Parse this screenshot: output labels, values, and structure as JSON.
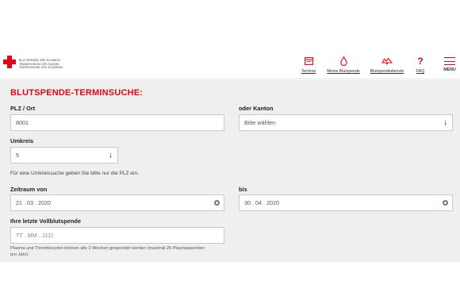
{
  "logo": {
    "line1": "Blutspende SRK Schweiz",
    "line2": "Transfusion CRS Suisse",
    "line3": "Trasfusione CRS Svizzera"
  },
  "nav": {
    "termine": "Termine",
    "meine": "Meine Blutspende",
    "dienste": "Blutspendedienste",
    "faq": "FAQ",
    "menu": "MENU"
  },
  "colors": {
    "accent": "#e30613",
    "section_bg": "#efefef"
  },
  "form": {
    "title": "BLUTSPENDE-TERMINSUCHE:",
    "plz_label": "PLZ / Ort",
    "plz_value": "8001",
    "kanton_label": "oder Kanton",
    "kanton_value": "Bitte wählen",
    "umkreis_label": "Umkreis",
    "umkreis_value": "5",
    "umkreis_hint": "Für eine Umkreissuche geben Sie bitte nur die PLZ ein.",
    "zeitraum_label": "Zeitraum von",
    "zeitraum_value": "21 . 03 . 2020",
    "bis_label": "bis",
    "bis_value": "30 . 04 . 2020",
    "letzte_label": "Ihre letzte Vollblutspende",
    "letzte_placeholder": "TT . MM . JJJJ",
    "note": "Plasma und Thrombozyten können alle 2 Wochen gespendet werden (maximal 25 Plasmaspenden pro Jahr)."
  }
}
